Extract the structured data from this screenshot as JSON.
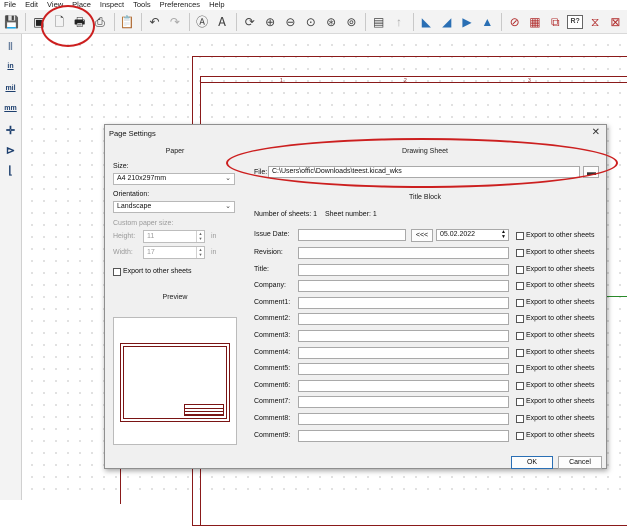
{
  "menu": [
    "File",
    "Edit",
    "View",
    "Place",
    "Inspect",
    "Tools",
    "Preferences",
    "Help"
  ],
  "toolbar_icons": [
    "save-icon",
    "page-settings-icon",
    "print-icon",
    "plot-icon",
    "paste-icon",
    "undo-icon",
    "redo-icon",
    "find-icon",
    "find-replace-icon",
    "refresh-icon",
    "zoom-in-icon",
    "zoom-out-icon",
    "zoom-fit-icon",
    "zoom-objects-icon",
    "zoom-selection-icon",
    "hierarchy-navigator-icon",
    "leave-sheet-icon",
    "rotate-ccw-icon",
    "rotate-cw-icon",
    "mirror-vertical-icon",
    "mirror-horizontal-icon",
    "erc-icon",
    "symbol-editor-icon",
    "annotate-icon",
    "netlist-icon"
  ],
  "sheet": {
    "columns": [
      "1",
      "2",
      "3"
    ]
  },
  "left_toolbar": {
    "inch": "in",
    "mil": "mil",
    "mm": "mm"
  },
  "dialog": {
    "title": "Page Settings",
    "close": "✕",
    "paper": {
      "header": "Paper",
      "size_label": "Size:",
      "size_value": "A4 210x297mm",
      "orientation_label": "Orientation:",
      "orientation_value": "Landscape",
      "custom_label": "Custom paper size:",
      "height_label": "Height:",
      "height_value": "11",
      "width_label": "Width:",
      "width_value": "17",
      "unit": "in",
      "export_label": "Export to other sheets",
      "preview_header": "Preview"
    },
    "drawing_sheet": {
      "header": "Drawing Sheet",
      "file_label": "File:",
      "file_value": "C:\\Users\\offic\\Downloads\\teest.kicad_wks"
    },
    "title_block": {
      "header": "Title Block",
      "num_sheets": "Number of sheets: 1",
      "sheet_number": "Sheet number: 1",
      "issue_date_label": "Issue Date:",
      "issue_date_value": "",
      "copy_date_button": "<<<",
      "date_picker_value": "05.02.2022",
      "fields": [
        "Revision:",
        "Title:",
        "Company:",
        "Comment1:",
        "Comment2:",
        "Comment3:",
        "Comment4:",
        "Comment5:",
        "Comment6:",
        "Comment7:",
        "Comment8:",
        "Comment9:"
      ],
      "export_label": "Export to other sheets"
    },
    "buttons": {
      "ok": "OK",
      "cancel": "Cancel"
    }
  }
}
